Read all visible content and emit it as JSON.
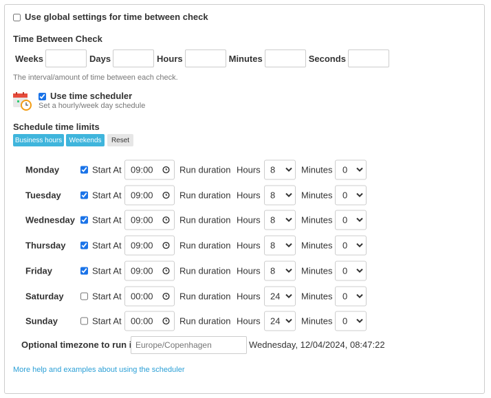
{
  "global": {
    "label": "Use global settings for time between check",
    "checked": false
  },
  "time_between": {
    "title": "Time Between Check",
    "fields": [
      {
        "label": "Weeks",
        "value": ""
      },
      {
        "label": "Days",
        "value": ""
      },
      {
        "label": "Hours",
        "value": ""
      },
      {
        "label": "Minutes",
        "value": ""
      },
      {
        "label": "Seconds",
        "value": ""
      }
    ],
    "hint": "The interval/amount of time between each check."
  },
  "scheduler": {
    "label": "Use time scheduler",
    "checked": true,
    "hint": "Set a hourly/week day schedule",
    "icon": "calendar-clock-icon"
  },
  "limits": {
    "title": "Schedule time limits",
    "buttons": [
      "Business hours",
      "Weekends",
      "Reset"
    ]
  },
  "labels": {
    "start_at": "Start At",
    "run_duration": "Run duration",
    "hours": "Hours",
    "minutes": "Minutes"
  },
  "days": [
    {
      "name": "Monday",
      "checked": true,
      "start": "09:00",
      "hours": "8",
      "minutes": "0"
    },
    {
      "name": "Tuesday",
      "checked": true,
      "start": "09:00",
      "hours": "8",
      "minutes": "0"
    },
    {
      "name": "Wednesday",
      "checked": true,
      "start": "09:00",
      "hours": "8",
      "minutes": "0"
    },
    {
      "name": "Thursday",
      "checked": true,
      "start": "09:00",
      "hours": "8",
      "minutes": "0"
    },
    {
      "name": "Friday",
      "checked": true,
      "start": "09:00",
      "hours": "8",
      "minutes": "0"
    },
    {
      "name": "Saturday",
      "checked": false,
      "start": "00:00",
      "hours": "24",
      "minutes": "0"
    },
    {
      "name": "Sunday",
      "checked": false,
      "start": "00:00",
      "hours": "24",
      "minutes": "0"
    }
  ],
  "timezone": {
    "label": "Optional timezone to run in",
    "placeholder": "Europe/Copenhagen",
    "value": "",
    "current_time": "Wednesday, 12/04/2024, 08:47:22"
  },
  "help_link": "More help and examples about using the scheduler"
}
